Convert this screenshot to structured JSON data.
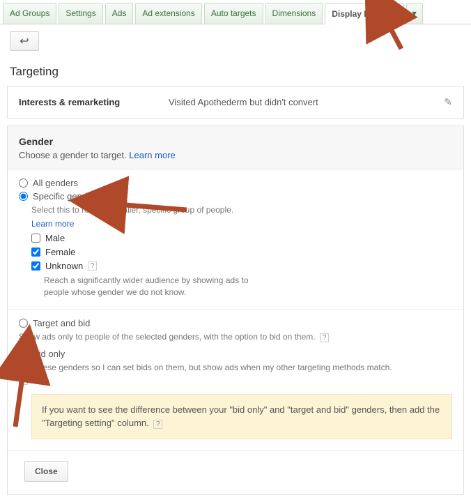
{
  "tabs": [
    "Ad Groups",
    "Settings",
    "Ads",
    "Ad extensions",
    "Auto targets",
    "Dimensions",
    "Display Network"
  ],
  "active_tab_index": 6,
  "page_heading": "Targeting",
  "summary": {
    "label": "Interests & remarketing",
    "value": "Visited Apothederm but didn't convert"
  },
  "gender_panel": {
    "title": "Gender",
    "subtitle_prefix": "Choose a gender to target. ",
    "learn_more": "Learn more",
    "option_all": "All genders",
    "option_specific": "Specific genders",
    "specific_help": "Select this to reach a smaller, specific group of people.",
    "specific_learn_more": "Learn more",
    "checkboxes": {
      "male": "Male",
      "female": "Female",
      "unknown": "Unknown"
    },
    "unknown_help": "Reach a significantly wider audience by showing ads to people whose gender we do not know.",
    "option_target_bid": "Target and bid",
    "target_bid_help": "Show ads only to people of the selected genders, with the option to bid on them.",
    "option_bid_only": "Bid only",
    "bid_only_help": "Add these genders so I can set bids on them, but show ads when my other targeting methods match.",
    "tip": "If you want to see the difference between your \"bid only\" and \"target and bid\" genders, then add the \"Targeting setting\" column."
  },
  "close_label": "Close"
}
